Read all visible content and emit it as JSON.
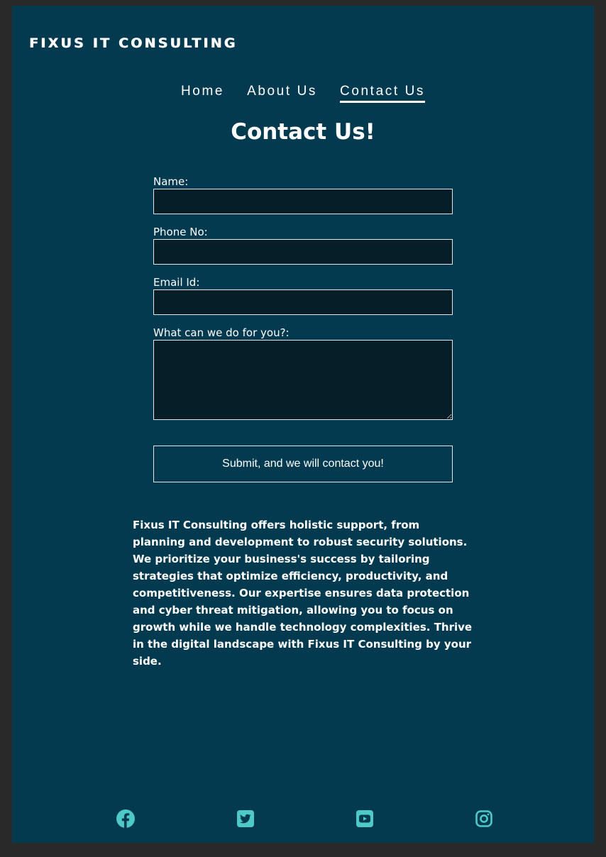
{
  "brand": {
    "name": "Fixus IT Consulting"
  },
  "nav": {
    "items": [
      {
        "label": "Home"
      },
      {
        "label": "About Us"
      },
      {
        "label": "Contact Us"
      }
    ],
    "active": "Contact Us"
  },
  "main": {
    "title": "Contact Us!",
    "form": {
      "name_label": "Name:",
      "name_value": "",
      "phone_label": "Phone No:",
      "phone_value": "",
      "email_label": "Email Id:",
      "email_value": "",
      "message_label": "What can we do for you?:",
      "message_value": "",
      "submit_label": "Submit, and we will contact you!"
    },
    "about_text": "Fixus IT Consulting offers holistic support, from planning and development to robust security solutions. We prioritize your business's success by tailoring strategies that optimize efficiency, productivity, and competitiveness. Our expertise ensures data protection and cyber threat mitigation, allowing you to focus on growth while we handle technology complexities. Thrive in the digital landscape with Fixus IT Consulting by your side."
  },
  "footer": {
    "social_icons": [
      "facebook-icon",
      "twitter-icon",
      "youtube-icon",
      "instagram-icon"
    ],
    "icon_color": "#4fc9c7"
  },
  "colors": {
    "page_background": "#043a4f",
    "outer_background": "#292929",
    "input_background": "#061e28",
    "text": "#ffffff"
  }
}
